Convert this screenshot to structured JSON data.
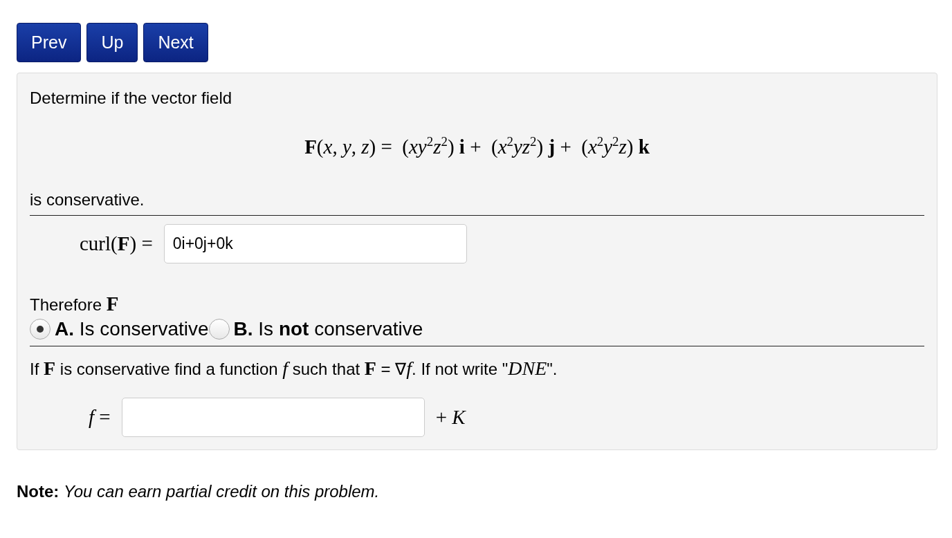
{
  "nav_buttons": [
    "Prev",
    "Up",
    "Next"
  ],
  "problem": {
    "intro": "Determine if the vector field",
    "formula": "**F**(*x*, *y*, *z*) =  (*xy*$^{2}$*z*$^{2}$) **i** +  (*x*$^{2}$*yz*$^{2}$) **j** +  (*x*$^{2}$*y*$^{2}$*z*) **k**",
    "after_formula": "is conservative.",
    "curl_answer": {
      "label": "curl(**F**) =",
      "value": "0i+0j+0k"
    },
    "therefore": "Therefore **F**",
    "options": [
      {
        "label": "**A.** Is conservative",
        "selected": true
      },
      {
        "label": "**B.** Is **not** conservative",
        "selected": false
      }
    ],
    "question": "If **F** is conservative find a function *f* such that **F** = ∇*f*. If not write \"*DNE*\".",
    "function_answer": {
      "label": "*f* =",
      "suffix": "+ *K*"
    }
  },
  "note": "**Note:** *You can earn partial credit on this problem.*"
}
